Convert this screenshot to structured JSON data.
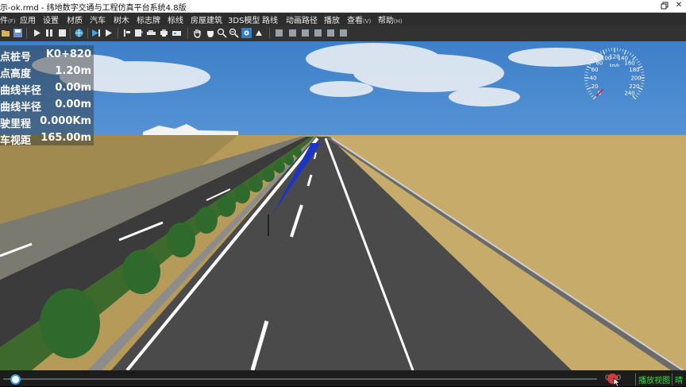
{
  "window": {
    "title": "示-ok.rmd - 纬地数字交通与工程仿真平台系统4.8版",
    "restore_icon": "restore-window-icon",
    "close_glyph": "✕"
  },
  "menu": [
    {
      "label": "件",
      "acc": "(F)"
    },
    {
      "label": "应用",
      "acc": ""
    },
    {
      "label": "设置",
      "acc": ""
    },
    {
      "label": "材质",
      "acc": ""
    },
    {
      "label": "汽车",
      "acc": ""
    },
    {
      "label": "树木",
      "acc": ""
    },
    {
      "label": "标志牌",
      "acc": ""
    },
    {
      "label": "标线",
      "acc": ""
    },
    {
      "label": "房屋建筑",
      "acc": ""
    },
    {
      "label": "3DS模型",
      "acc": ""
    },
    {
      "label": "路线",
      "acc": ""
    },
    {
      "label": "动画路径",
      "acc": ""
    },
    {
      "label": "播放",
      "acc": ""
    },
    {
      "label": "查看",
      "acc": "(V)"
    },
    {
      "label": "帮助",
      "acc": "(H)"
    }
  ],
  "toolbar_icons": [
    "open-file-icon",
    "save-icon",
    "play-icon",
    "pause-icon",
    "stop-icon",
    "globe-icon",
    "play-forward-icon",
    "step-forward-icon",
    "marker-icon",
    "camera-icon",
    "car-icon",
    "print-icon",
    "pan-hand-icon",
    "grab-hand-icon",
    "zoom-in-icon",
    "zoom-out-icon",
    "view-eye-icon",
    "cube-view-1-icon",
    "cube-view-2-icon",
    "cube-view-3-icon",
    "cube-view-4-icon",
    "cube-view-5-icon"
  ],
  "info_panel": [
    {
      "label": "点桩号",
      "value": "K0+820"
    },
    {
      "label": "点高度",
      "value": "1.20m"
    },
    {
      "label": "曲线半径",
      "value": "0.00m"
    },
    {
      "label": "曲线半径",
      "value": "0.00m"
    },
    {
      "label": "驶里程",
      "value": "0.000Km"
    },
    {
      "label": "车视距",
      "value": "165.00m"
    }
  ],
  "speedometer": {
    "unit": "km/h",
    "ticks": [
      "0",
      "20",
      "40",
      "60",
      "80",
      "100",
      "120",
      "140",
      "160",
      "180",
      "200",
      "220",
      "240"
    ],
    "speed": 0
  },
  "bottom": {
    "progress": 0.012,
    "time_text": "0:00",
    "play_view_label": "播放视图",
    "weather_label": "晴"
  },
  "colors": {
    "menubar": "#2d2d2d",
    "toolbar": "#323232",
    "status_green": "#48d548",
    "slider_accent": "#3aa6e8",
    "record_red": "#d33a3a"
  }
}
